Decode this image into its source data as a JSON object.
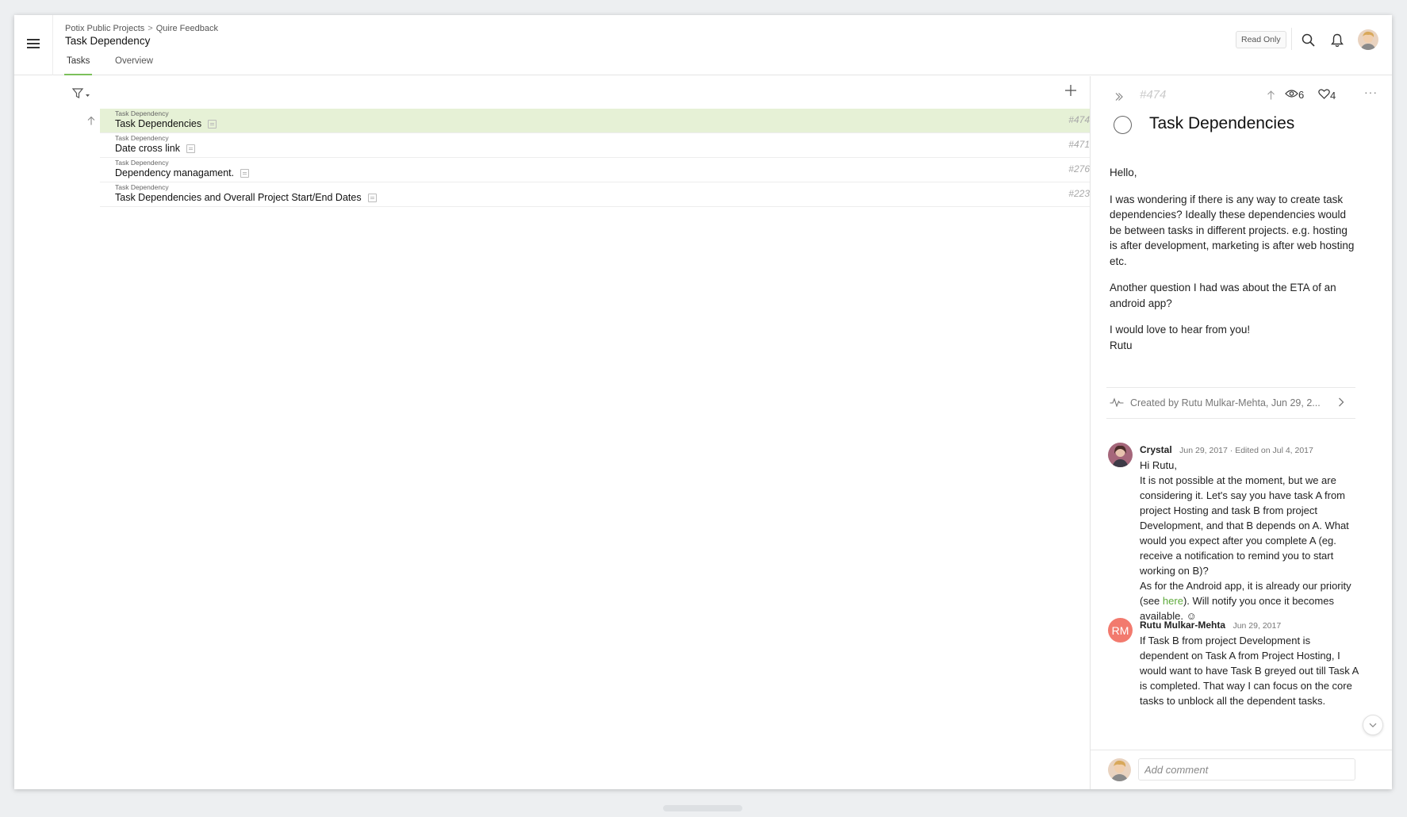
{
  "header": {
    "breadcrumb": [
      "Potix Public Projects",
      "Quire Feedback"
    ],
    "breadcrumb_separator": ">",
    "title": "Task Dependency",
    "tabs": [
      {
        "label": "Tasks",
        "active": true
      },
      {
        "label": "Overview",
        "active": false
      }
    ],
    "read_only_label": "Read Only"
  },
  "tasks": [
    {
      "category": "Task Dependency",
      "name": "Task Dependencies",
      "id": "#474",
      "selected": true
    },
    {
      "category": "Task Dependency",
      "name": "Date cross link",
      "id": "#471",
      "selected": false
    },
    {
      "category": "Task Dependency",
      "name": "Dependency managament.",
      "id": "#276",
      "selected": false
    },
    {
      "category": "Task Dependency",
      "name": "Task Dependencies and Overall Project Start/End Dates",
      "id": "#223",
      "selected": false
    }
  ],
  "detail": {
    "id": "#474",
    "watchers": "6",
    "likes": "4",
    "more": "···",
    "title": "Task Dependencies",
    "description": [
      "Hello,",
      "I was wondering if there is any way to create task dependencies? Ideally these dependencies would be between tasks in different projects. e.g. hosting is after development, marketing is after web hosting etc.",
      "Another question I had was about the ETA of an android app?",
      "I would love to hear from you!",
      "Rutu"
    ],
    "activity": "Created by Rutu Mulkar-Mehta, Jun 29, 2...",
    "comments": [
      {
        "author": "Crystal",
        "meta": "Jun 29, 2017 · Edited on Jul 4, 2017",
        "greeting": "Hi Rutu,",
        "body1": "It is not possible at the moment, but we are considering it. Let's say you have task A from project Hosting and task B from project Development, and that B depends on A. What would you expect after you complete A (eg. receive a notification to remind you to start working on B)?",
        "body2_before": "As for the Android app, it is already our priority (see ",
        "link": "here",
        "body2_after": "). Will notify you once it becomes available. ☺"
      },
      {
        "author": "Rutu Mulkar-Mehta",
        "initials": "RM",
        "meta": "Jun 29, 2017",
        "body": "If Task B from project Development is dependent on Task A from Project Hosting, I would want to have Task B greyed out till Task A is completed. That way I can focus on the core tasks to unblock all the dependent tasks."
      }
    ],
    "comment_placeholder": "Add comment"
  },
  "colors": {
    "accent": "#7cc05b",
    "selected_row": "#e6f1d6",
    "link": "#5da93a",
    "rm_avatar": "#f27a6e"
  }
}
